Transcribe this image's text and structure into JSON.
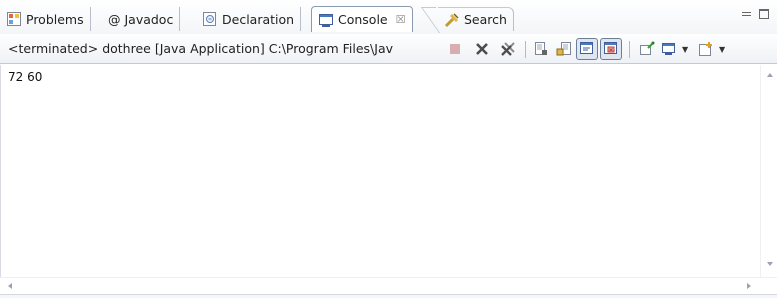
{
  "tabs": [
    {
      "label": "Problems",
      "icon": "problems-icon"
    },
    {
      "label": "@ Javadoc",
      "icon": "javadoc-icon"
    },
    {
      "label": "Declaration",
      "icon": "declaration-icon"
    },
    {
      "label": "Console",
      "icon": "console-icon",
      "active": true,
      "close": "☒"
    },
    {
      "label": "Search",
      "icon": "search-icon"
    }
  ],
  "status": {
    "text": "<terminated> dothree [Java Application] C:\\Program Files\\Jav"
  },
  "toolbar": {
    "buttons": [
      "terminate-icon",
      "remove-launch-icon",
      "remove-all-terminated-icon",
      "clear-console-icon",
      "scroll-lock-icon",
      "word-wrap-icon",
      "show-console-on-output-icon",
      "pin-console-icon",
      "display-selected-console-icon",
      "open-console-icon"
    ]
  },
  "console": {
    "output": "72 60"
  },
  "colors": {
    "accent": "#4a79c4",
    "tab_border": "#8a9bb0",
    "red": "#c0392b"
  }
}
